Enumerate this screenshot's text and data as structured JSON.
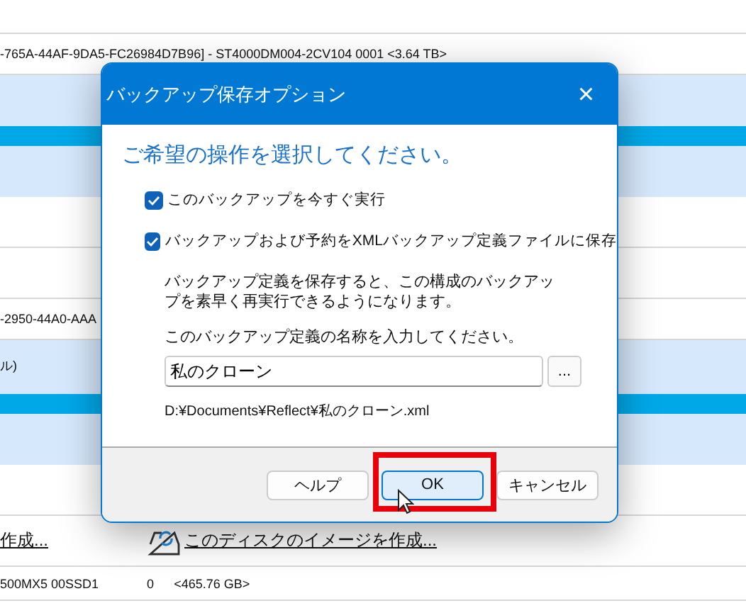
{
  "background": {
    "rows": [
      {
        "kind": "blank"
      },
      {
        "kind": "text",
        "cells": [
          "-765A-44AF-9DA5-FC26984D7B96] - ST4000DM004-2CV104 0001  <3.64 TB>"
        ]
      },
      {
        "kind": "band"
      },
      {
        "kind": "accent"
      },
      {
        "kind": "band"
      },
      {
        "kind": "plain"
      },
      {
        "kind": "plain"
      },
      {
        "kind": "text",
        "cells": [
          "-2950-44A0-AAA"
        ]
      },
      {
        "kind": "bandtext",
        "cells": [
          "ル)"
        ]
      },
      {
        "kind": "accent"
      },
      {
        "kind": "band"
      },
      {
        "kind": "plain"
      },
      {
        "kind": "links",
        "cells": [
          "作成...",
          "このディスクのイメージを作成..."
        ]
      },
      {
        "kind": "disk",
        "cells": [
          "500MX5 00SSD1",
          "0",
          "<465.76 GB>"
        ]
      }
    ]
  },
  "dialog": {
    "title": "バックアップ保存オプション",
    "close": "×",
    "heading": "ご希望の操作を選択してください。",
    "options": [
      {
        "label": "このバックアップを今すぐ実行",
        "checked": true
      },
      {
        "label": "バックアップおよび予約をXMLバックアップ定義ファイルに保存",
        "checked": true
      }
    ],
    "description": "バックアップ定義を保存すると、この構成のバックアップを素早く再実行できるようになります。",
    "name_label": "このバックアップ定義の名称を入力してください。",
    "name_field": {
      "value": "私のクローン"
    },
    "browse": "...",
    "path": "D:¥Documents¥Reflect¥私のクローン.xml",
    "buttons": [
      {
        "label": "ヘルプ",
        "highlighted": false
      },
      {
        "label": "OK",
        "highlighted": true
      },
      {
        "label": "キャンセル",
        "highlighted": false
      }
    ]
  }
}
